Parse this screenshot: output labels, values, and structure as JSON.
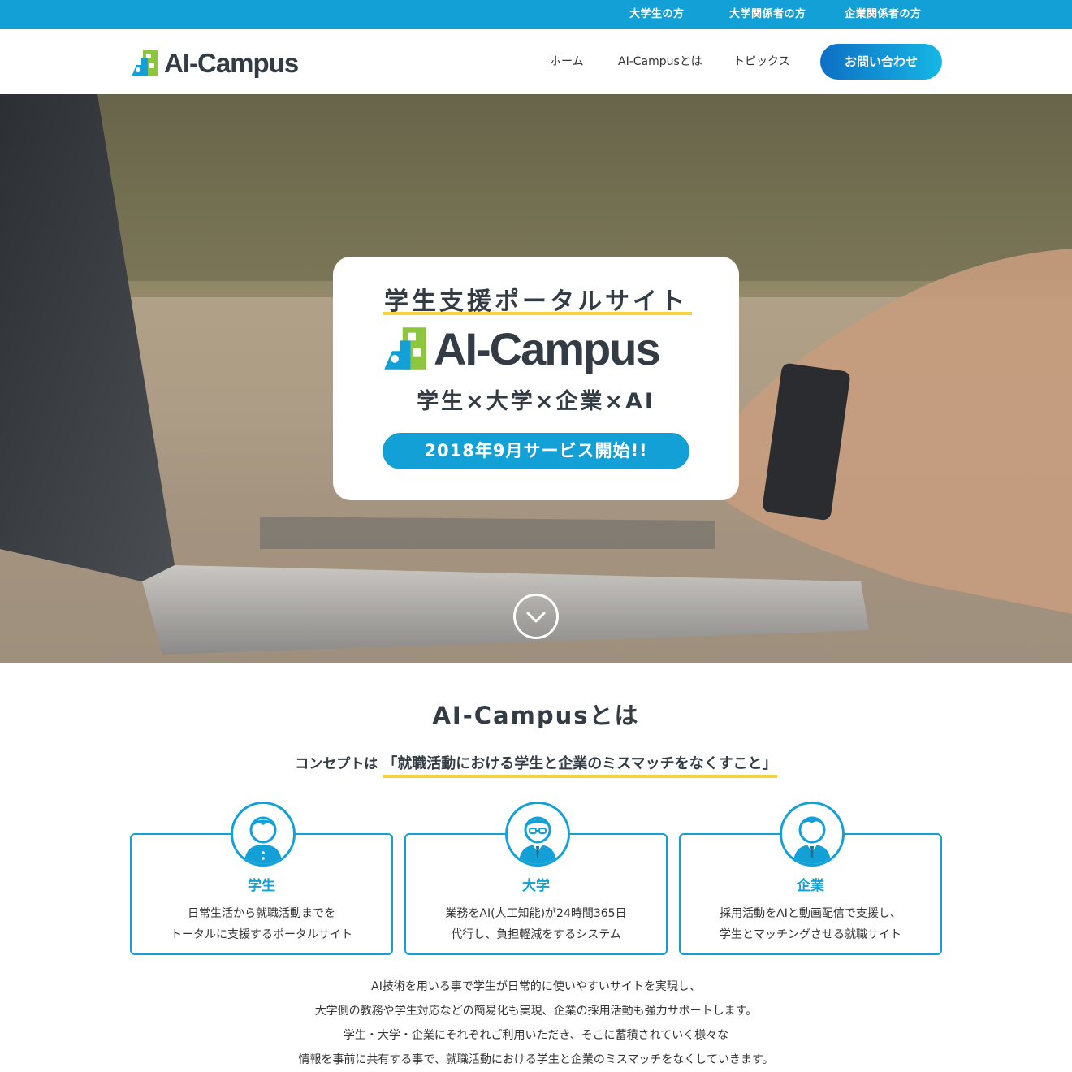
{
  "topbar": {
    "links": [
      "大学生の方",
      "大学関係者の方",
      "企業関係者の方"
    ]
  },
  "header": {
    "logo_text": "AI-Campus",
    "nav": [
      "ホーム",
      "AI-Campusとは",
      "トピックス"
    ],
    "contact_label": "お問い合わせ"
  },
  "hero": {
    "subtitle": "学生支援ポータルサイト",
    "logo_text": "AI-Campus",
    "tagline": "学生×大学×企業×AI",
    "launch": "2018年9月サービス開始!!"
  },
  "about": {
    "title": "AI-Campusとは",
    "concept_prefix": "コンセプトは",
    "concept_text": "「就職活動における学生と企業のミスマッチをなくすこと」",
    "cards": [
      {
        "title": "学生",
        "line1": "日常生活から就職活動までを",
        "line2": "トータルに支援するポータルサイト"
      },
      {
        "title": "大学",
        "line1": "業務をAI(人工知能)が24時間365日",
        "line2": "代行し、負担軽減をするシステム"
      },
      {
        "title": "企業",
        "line1": "採用活動をAIと動画配信で支援し、",
        "line2": "学生とマッチングさせる就職サイト"
      }
    ],
    "summary": [
      "AI技術を用いる事で学生が日常的に使いやすいサイトを実現し、",
      "大学側の教務や学生対応などの簡易化も実現、企業の採用活動も強力サポートします。",
      "学生・大学・企業にそれぞれご利用いただき、そこに蓄積されていく様々な",
      "情報を事前に共有する事で、就職活動における学生と企業のミスマッチをなくしていきます。"
    ]
  },
  "colors": {
    "brand_blue": "#12a0d7",
    "accent_yellow": "#f6d33a",
    "logo_green": "#8cc63e",
    "text_dark": "#333c44"
  }
}
